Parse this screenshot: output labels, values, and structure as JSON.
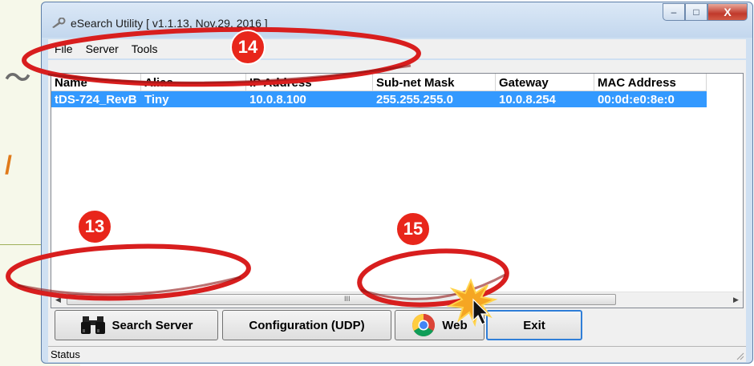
{
  "window": {
    "title": "eSearch Utility [ v1.1.13, Nov.29, 2016 ]",
    "controls": [
      "minimize-icon",
      "maximize-icon",
      "close-icon"
    ]
  },
  "menu": [
    "File",
    "Server",
    "Tools"
  ],
  "table": {
    "columns": [
      "Name",
      "Alias",
      "IP Address",
      "Sub-net Mask",
      "Gateway",
      "MAC Address"
    ],
    "rows": [
      [
        "tDS-724_RevB",
        "Tiny",
        "10.0.8.100",
        "255.255.255.0",
        "10.0.8.254",
        "00:0d:e0:8e:0"
      ]
    ]
  },
  "scrollbar_grip": "III",
  "buttons": {
    "search": "Search Server",
    "config": "Configuration (UDP)",
    "web": "Web",
    "exit": "Exit"
  },
  "status": "Status",
  "annotations": {
    "menu_callout": "14",
    "search_callout": "13",
    "web_callout": "15"
  },
  "colors": {
    "selection": "#3399ff",
    "callout_red": "#e8261b",
    "click_burst": "#f5a623"
  },
  "icons": {
    "app": "wrench-icon",
    "search": "binoculars-icon",
    "web": "chrome-icon",
    "cursor": "mouse-pointer-icon"
  }
}
